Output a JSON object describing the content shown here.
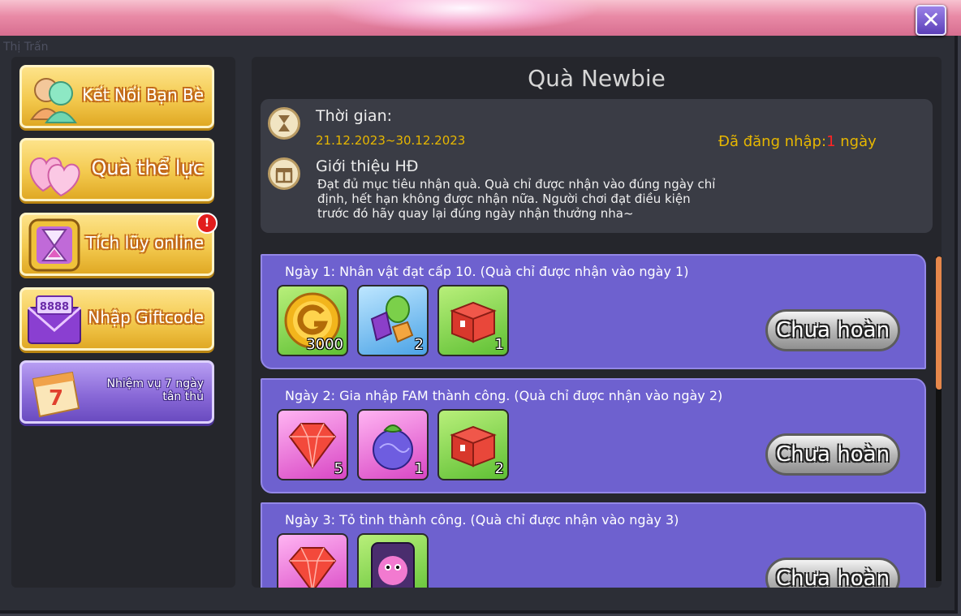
{
  "header": {
    "background_hint": "Thị Trấn",
    "close_symbol": "✕"
  },
  "sidebar": {
    "items": [
      {
        "label": "Kết Nối Bạn Bè",
        "icon": "friends-icon"
      },
      {
        "label": "Quà thể lực",
        "icon": "hearts-icon"
      },
      {
        "label": "Tích lũy online",
        "icon": "hourglass-icon",
        "alert": "!"
      },
      {
        "label": "Nhập Giftcode",
        "icon": "envelope-icon",
        "envelope_code": "8888"
      },
      {
        "label_line1": "Nhiệm vụ 7 ngày",
        "label_line2": "tân thủ",
        "icon": "calendar-icon",
        "calendar_number": "7"
      }
    ]
  },
  "panel": {
    "title": "Quà Newbie",
    "time_label": "Thời gian:",
    "date_range": "21.12.2023~30.12.2023",
    "login_prefix": "Đã đăng nhập:",
    "login_days": "1",
    "login_suffix": " ngày",
    "intro_label": "Giới thiệu HĐ",
    "description": "Đạt đủ mục tiêu nhận quà. Quà chỉ được nhận vào đúng ngày chỉ định, hết hạn không được nhận nữa. Người chơi đạt điều kiện trước đó hãy quay lại đúng ngày nhận thưởng nha~"
  },
  "days": [
    {
      "title": "Ngày 1: Nhân vật đạt cấp 10. (Quà chỉ được nhận vào ngày 1)",
      "rewards": [
        {
          "item": "gold-coin-icon",
          "bg": "green",
          "qty": "3000"
        },
        {
          "item": "candy-gems-icon",
          "bg": "blue",
          "qty": "2"
        },
        {
          "item": "red-chest-icon",
          "bg": "green",
          "qty": "1"
        }
      ],
      "status": "Chưa hoàn"
    },
    {
      "title": "Ngày 2: Gia nhập FAM thành công. (Quà chỉ được nhận vào ngày 2)",
      "rewards": [
        {
          "item": "red-gem-icon",
          "bg": "pink",
          "qty": "5"
        },
        {
          "item": "devil-fruit-icon",
          "bg": "pink",
          "qty": "1"
        },
        {
          "item": "red-chest-icon",
          "bg": "green",
          "qty": "2"
        }
      ],
      "status": "Chưa hoàn"
    },
    {
      "title": "Ngày 3: Tỏ tình thành công. (Quà chỉ được nhận vào ngày 3)",
      "rewards": [
        {
          "item": "red-gem-icon",
          "bg": "pink",
          "qty": ""
        },
        {
          "item": "pet-card-icon",
          "bg": "green",
          "qty": ""
        }
      ],
      "status": "Chưa hoàn"
    }
  ]
}
